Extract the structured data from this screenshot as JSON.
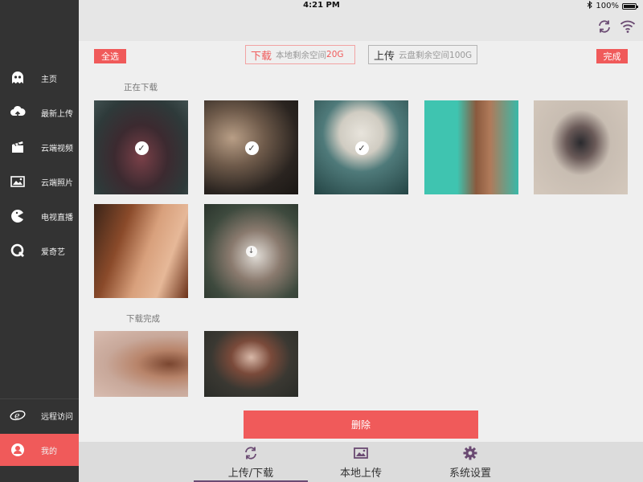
{
  "status_bar": {
    "time": "4:21 PM",
    "battery": "100%",
    "battery_level": 1.0
  },
  "colors": {
    "accent": "#f05a5a",
    "sidebar_bg": "#333333",
    "icon_purple": "#6a4a72"
  },
  "toolbar": {
    "refresh_icon": "refresh-icon",
    "wifi_icon": "wifi-icon"
  },
  "sidebar": {
    "items": [
      {
        "label": "主页",
        "icon": "ghost-icon"
      },
      {
        "label": "最新上传",
        "icon": "cloud-upload-icon"
      },
      {
        "label": "云端视频",
        "icon": "clapperboard-icon"
      },
      {
        "label": "云端照片",
        "icon": "photo-icon"
      },
      {
        "label": "电视直播",
        "icon": "pacman-icon"
      },
      {
        "label": "爱奇艺",
        "icon": "iqiyi-icon"
      }
    ],
    "bottom_items": [
      {
        "label": "远程访问",
        "icon": "remote-icon"
      },
      {
        "label": "我的",
        "icon": "user-icon"
      }
    ]
  },
  "actions": {
    "select_all": "全选",
    "done": "完成",
    "download_tab": {
      "label": "下载",
      "info_prefix": "本地剩余空间",
      "info_value": "20G"
    },
    "upload_tab": {
      "label": "上传",
      "info": "云盘剩余空间100G"
    }
  },
  "sections": {
    "downloading": "正在下载",
    "completed": "下载完成"
  },
  "delete_label": "删除",
  "tabs": [
    {
      "label": "上传/下载",
      "icon": "sync-icon"
    },
    {
      "label": "本地上传",
      "icon": "image-upload-icon"
    },
    {
      "label": "系统设置",
      "icon": "gear-icon"
    }
  ]
}
